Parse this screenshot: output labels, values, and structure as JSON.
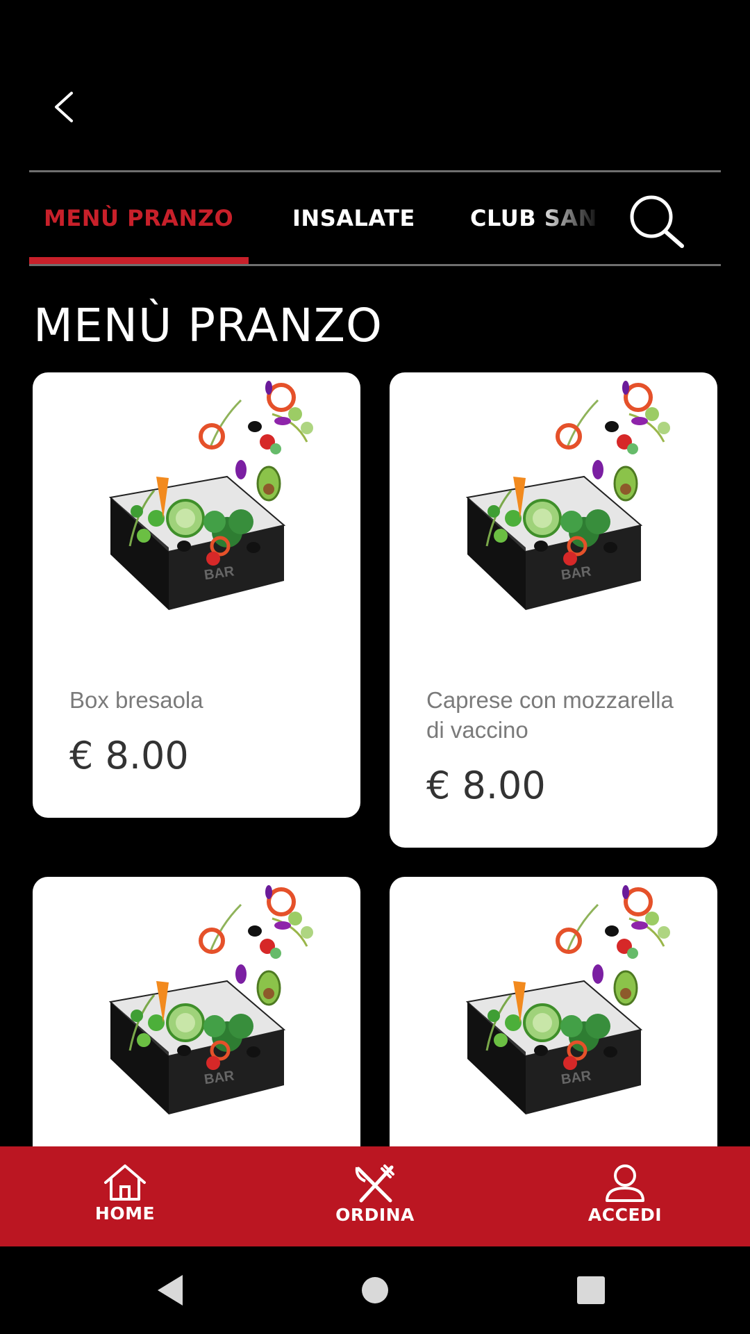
{
  "header": {
    "back_icon": "chevron-left-icon"
  },
  "tabs": [
    {
      "label": "MENÙ PRANZO",
      "active": true
    },
    {
      "label": "INSALATE",
      "active": false
    },
    {
      "label": "CLUB SAN",
      "active": false
    }
  ],
  "search": {
    "icon": "search-icon"
  },
  "section": {
    "title": "MENÙ PRANZO"
  },
  "products": [
    {
      "name": "Box bresaola",
      "price": "€ 8.00",
      "image": "salad-box-image"
    },
    {
      "name": "Caprese con mozzarella di vaccino",
      "price": "€ 8.00",
      "image": "salad-box-image"
    },
    {
      "name": "",
      "price": "",
      "image": "salad-box-image"
    },
    {
      "name": "",
      "price": "",
      "image": "salad-box-image"
    }
  ],
  "bottom_nav": {
    "items": [
      {
        "label": "HOME",
        "icon": "home-icon"
      },
      {
        "label": "ORDINA",
        "icon": "fork-knife-icon"
      },
      {
        "label": "ACCEDI",
        "icon": "user-icon"
      }
    ]
  },
  "colors": {
    "accent": "#c8202a",
    "nav_bar": "#bb1622",
    "background": "#000000",
    "card": "#ffffff"
  }
}
